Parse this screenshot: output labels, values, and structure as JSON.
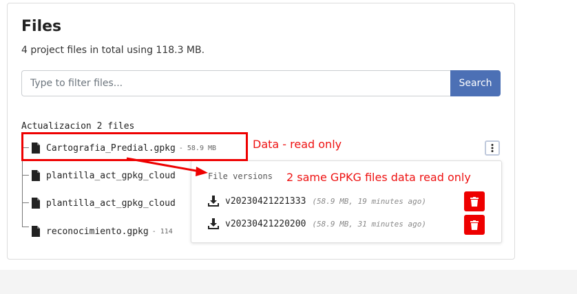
{
  "files_panel": {
    "title": "Files",
    "summary": "4 project files in total using 118.3 MB.",
    "filter_placeholder": "Type to filter files...",
    "search_label": "Search"
  },
  "folder": {
    "label": "Actualizacion 2 files"
  },
  "files": [
    {
      "name": "Cartografia_Predial.gpkg",
      "size": "- 58.9 MB"
    },
    {
      "name": "plantilla_act_gpkg_cloud",
      "size": ""
    },
    {
      "name": "plantilla_act_gpkg_cloud",
      "size": ""
    },
    {
      "name": "reconocimiento.gpkg",
      "size": "- 114"
    }
  ],
  "versions_popover": {
    "title": "File versions",
    "versions": [
      {
        "name": "v20230421221333",
        "meta": "(58.9 MB, 19 minutes ago)"
      },
      {
        "name": "v20230421220200",
        "meta": "(58.9 MB, 31 minutes ago)"
      }
    ]
  },
  "annotations": {
    "data_read_only": "Data - read only",
    "same_gpkg": "2 same GPKG files data read only"
  },
  "colors": {
    "accent": "#4c70b5",
    "annotation_red": "#ee0000",
    "delete_red": "#ee0000"
  },
  "icons": {
    "file": "file-icon",
    "download": "download-icon",
    "delete": "trash-icon",
    "menu": "kebab-menu-icon"
  }
}
